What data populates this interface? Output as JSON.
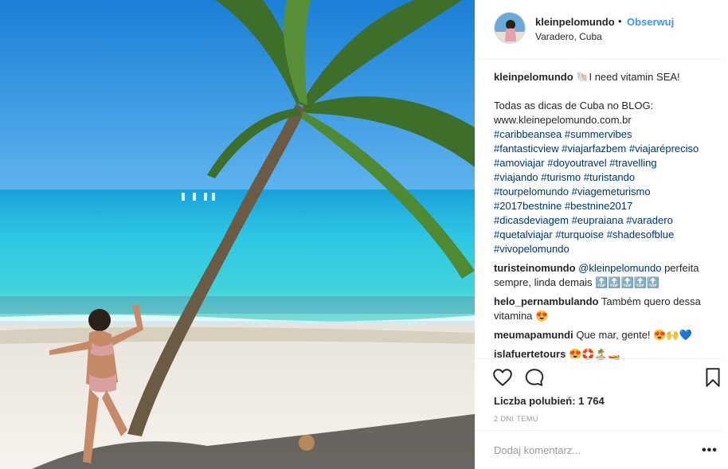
{
  "header": {
    "username": "kleinpelomundo",
    "separator": "•",
    "follow_label": "Obserwuj",
    "location": "Varadero, Cuba"
  },
  "caption": {
    "username": "kleinpelomundo",
    "first_line": "🐚I need vitamin SEA!",
    "body": "Todas as dicas de Cuba no BLOG:\nwww.kleinepelomundo.com.br",
    "hashtags": [
      "#caribbeansea",
      "#summervibes",
      "#fantasticview",
      "#viajarfazbem",
      "#viajarépreciso",
      "#amoviajar",
      "#doyoutravel",
      "#travelling",
      "#viajando",
      "#turismo",
      "#turistando",
      "#tourpelomundo",
      "#viagemeturismo",
      "#2017bestnine",
      "#bestnine2017",
      "#dicasdeviagem",
      "#eupraiana",
      "#varadero",
      "#quetalviajar",
      "#turquoise",
      "#shadesofblue",
      "#vivopelomundo"
    ]
  },
  "comments": [
    {
      "user": "turisteinomundo",
      "mention": "@kleinpelomundo",
      "text": "perfeita sempre, linda demais 🔝🔝🔝🔝🔝"
    },
    {
      "user": "helo_pernambulando",
      "mention": "",
      "text": "Também quero dessa vitamina 😍"
    },
    {
      "user": "meumapamundi",
      "mention": "",
      "text": "Que mar, gente! 😍🙌💙"
    },
    {
      "user": "islafuertetours",
      "mention": "",
      "text": "😍🛟🏝️🚤"
    }
  ],
  "actions": {
    "like_icon": "heart-icon",
    "comment_icon": "comment-bubble-icon",
    "save_icon": "bookmark-icon"
  },
  "likes": "Liczba polubień: 1 764",
  "timestamp": "2 DNI TEMU",
  "add_comment": {
    "placeholder": "Dodaj komentarz...",
    "more_label": "•••"
  },
  "colors": {
    "link": "#3897f0",
    "hashtag": "#003569",
    "muted": "#999999",
    "divider": "#efefef"
  }
}
